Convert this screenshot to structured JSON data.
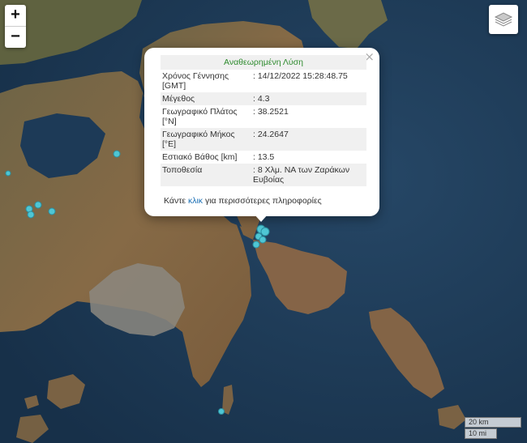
{
  "controls": {
    "zoom_in": "+",
    "zoom_out": "−",
    "layers_icon": "layers-icon"
  },
  "popup": {
    "title": "Αναθεωρημένη Λύση",
    "close": "×",
    "rows": [
      {
        "label": "Χρόνος Γέννησης [GMT]",
        "value": ": 14/12/2022 15:28:48.75"
      },
      {
        "label": "Μέγεθος",
        "value": ": 4.3"
      },
      {
        "label": "Γεωγραφικό Πλάτος [°N]",
        "value": ": 38.2521"
      },
      {
        "label": "Γεωγραφικό Μήκος [°E]",
        "value": ": 24.2647"
      },
      {
        "label": "Εστιακό Βάθος [km]",
        "value": ": 13.5"
      },
      {
        "label": "Τοποθεσία",
        "value": ": 8 Χλμ. ΝΑ των Ζαράκων Ευβοίας"
      }
    ],
    "footer_pre": "Κάντε ",
    "footer_link": "κλικ",
    "footer_post": " για περισσότερες πληροφορίες"
  },
  "scale": {
    "km": "20 km",
    "mi": "10 mi"
  },
  "colors": {
    "marker": "#4fc6d4",
    "land": "#7a6244",
    "sea": "#1f3a55"
  }
}
